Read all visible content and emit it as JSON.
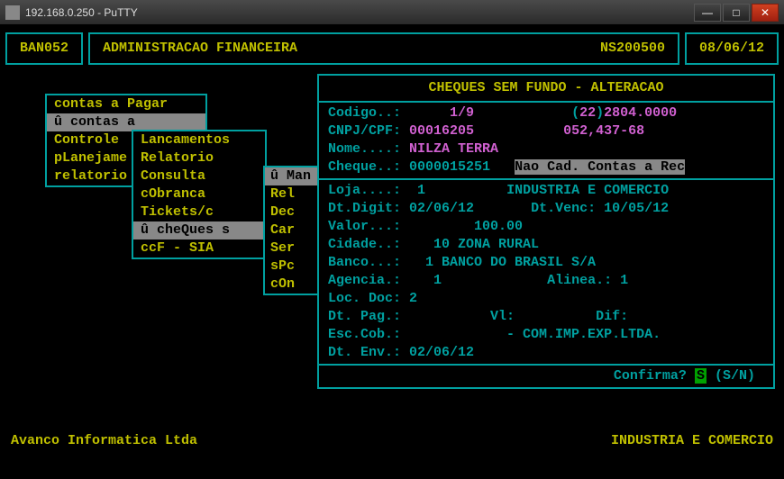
{
  "window": {
    "title": "192.168.0.250 - PuTTY"
  },
  "header": {
    "code": "BAN052",
    "app_title": "ADMINISTRACAO FINANCEIRA",
    "session": "NS200500",
    "date": "08/06/12"
  },
  "menu1": {
    "top": "contas a Pagar",
    "items": [
      "û contas a",
      "Controle",
      "pLanejame",
      "relatorio"
    ],
    "selected": 0
  },
  "menu2": {
    "items": [
      "Lancamentos",
      "Relatorio",
      "Consulta",
      "cObranca",
      "Tickets/c",
      "û cheQues s",
      "ccF - SIA"
    ],
    "selected": 5
  },
  "menu3": {
    "items": [
      "û Man",
      "Rel",
      "Dec",
      "Car",
      "Ser",
      "sPc",
      "cOn"
    ],
    "selected": 0
  },
  "panel": {
    "title": "CHEQUES SEM FUNDO - ALTERACAO",
    "codigo_label": "Codigo..:",
    "codigo_val": "1/9",
    "codigo_paren": "(",
    "codigo_ref": "22",
    "codigo_paren2": ")",
    "codigo_phone": "2804.0000",
    "cnpj_label": "CNPJ/CPF:",
    "cnpj_val": "00016205",
    "cnpj_val2": "052,437-68",
    "nome_label": "Nome....:",
    "nome_val": "NILZA TERRA",
    "cheque_label": "Cheque..:",
    "cheque_val": "0000015251",
    "cheque_status": "Nao Cad. Contas a Rec",
    "loja_label": "Loja....:",
    "loja_val": "1",
    "loja_name": "INDUSTRIA E COMERCIO",
    "dtdigit_label": "Dt.Digit:",
    "dtdigit_val": "02/06/12",
    "dtvenc_label": "Dt.Venc:",
    "dtvenc_val": "10/05/12",
    "valor_label": "Valor...:",
    "valor_val": "100.00",
    "cidade_label": "Cidade..:",
    "cidade_val": "10 ZONA RURAL",
    "banco_label": "Banco...:",
    "banco_val": "1 BANCO DO BRASIL S/A",
    "agencia_label": "Agencia.:",
    "agencia_val": "1",
    "alinea_label": "Alinea.:",
    "alinea_val": "1",
    "locdoc_label": "Loc. Doc:",
    "locdoc_val": "2",
    "dtpag_label": "Dt. Pag.:",
    "vl_label": "Vl:",
    "dif_label": "Dif:",
    "esccob_label": "Esc.Cob.:",
    "esccob_val": "- COM.IMP.EXP.LTDA.",
    "dtenv_label": "Dt. Env.:",
    "dtenv_val": "02/06/12",
    "confirm_label": "Confirma?",
    "confirm_val": "S",
    "confirm_opts": "(S/N)"
  },
  "footer": {
    "left": "Avanco Informatica Ltda",
    "right": "INDUSTRIA E COMERCIO"
  }
}
